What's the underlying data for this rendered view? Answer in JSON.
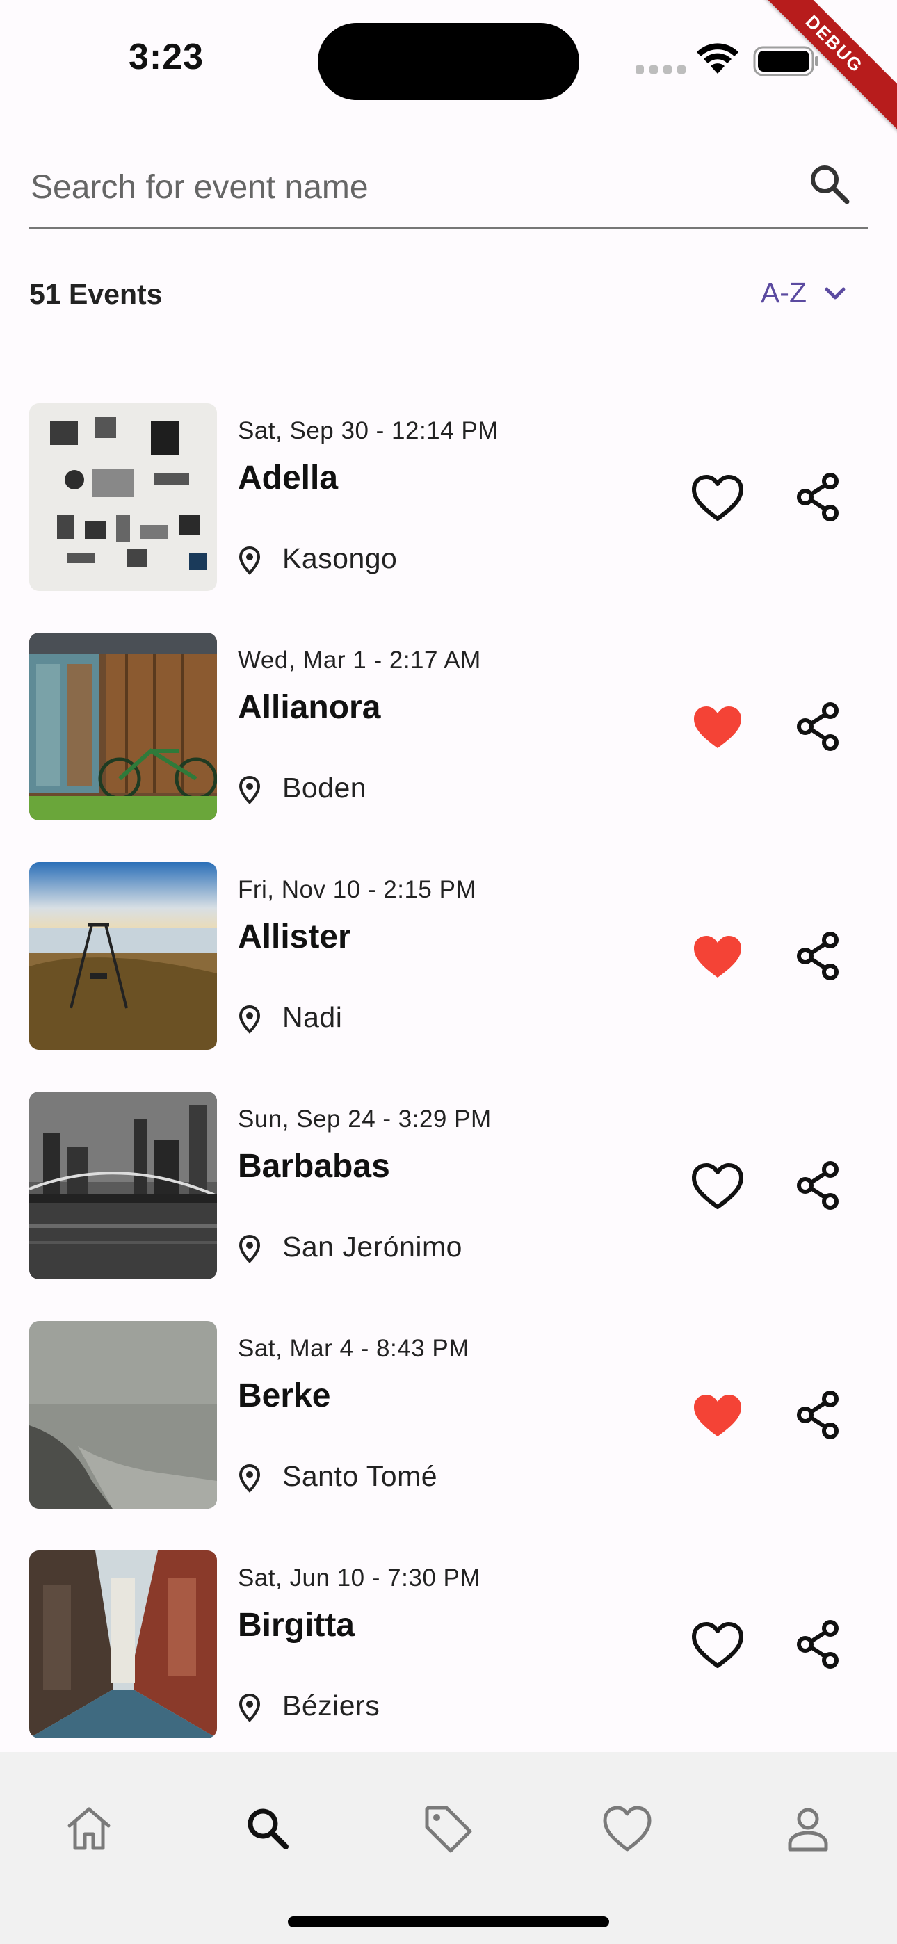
{
  "status_bar": {
    "time": "3:23",
    "debug_label": "DEBUG"
  },
  "search": {
    "placeholder": "Search for event name",
    "value": ""
  },
  "list_header": {
    "count_label": "51 Events",
    "sort_label": "A-Z"
  },
  "events": [
    {
      "date": "Sat, Sep 30 - 12:14 PM",
      "name": "Adella",
      "location": "Kasongo",
      "favorited": false,
      "image": "flat-lay-objects"
    },
    {
      "date": "Wed, Mar 1 - 2:17 AM",
      "name": "Allianora",
      "location": "Boden",
      "favorited": true,
      "image": "wooden-shed-bicycle"
    },
    {
      "date": "Fri, Nov 10 - 2:15 PM",
      "name": "Allister",
      "location": "Nadi",
      "favorited": true,
      "image": "coast-swing"
    },
    {
      "date": "Sun, Sep 24 - 3:29 PM",
      "name": "Barbabas",
      "location": "San Jerónimo",
      "favorited": false,
      "image": "bridge-night-bw"
    },
    {
      "date": "Sat, Mar 4 - 8:43 PM",
      "name": "Berke",
      "location": "Santo Tomé",
      "favorited": true,
      "image": "foggy-beach"
    },
    {
      "date": "Sat, Jun 10 - 7:30 PM",
      "name": "Birgitta",
      "location": "Béziers",
      "favorited": false,
      "image": "city-street"
    }
  ],
  "bottom_nav": {
    "items": [
      {
        "icon": "home-icon",
        "active": false
      },
      {
        "icon": "search-icon",
        "active": true
      },
      {
        "icon": "tag-icon",
        "active": false
      },
      {
        "icon": "heart-icon",
        "active": false
      },
      {
        "icon": "person-icon",
        "active": false
      }
    ]
  },
  "colors": {
    "favorite": "#f44336",
    "accent": "#5b4aa0",
    "nav_background": "#f1f1f1"
  }
}
